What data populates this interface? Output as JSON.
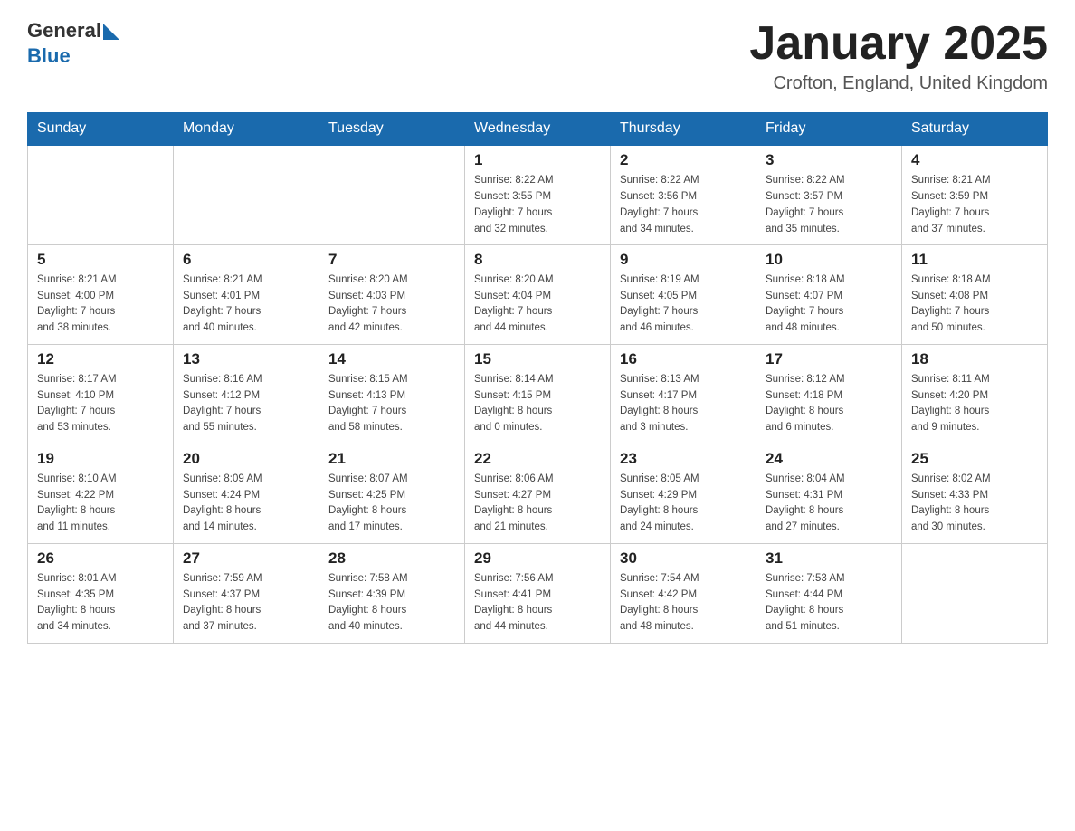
{
  "header": {
    "logo_general": "General",
    "logo_blue": "Blue",
    "title": "January 2025",
    "subtitle": "Crofton, England, United Kingdom"
  },
  "weekdays": [
    "Sunday",
    "Monday",
    "Tuesday",
    "Wednesday",
    "Thursday",
    "Friday",
    "Saturday"
  ],
  "weeks": [
    [
      {
        "day": "",
        "info": ""
      },
      {
        "day": "",
        "info": ""
      },
      {
        "day": "",
        "info": ""
      },
      {
        "day": "1",
        "info": "Sunrise: 8:22 AM\nSunset: 3:55 PM\nDaylight: 7 hours\nand 32 minutes."
      },
      {
        "day": "2",
        "info": "Sunrise: 8:22 AM\nSunset: 3:56 PM\nDaylight: 7 hours\nand 34 minutes."
      },
      {
        "day": "3",
        "info": "Sunrise: 8:22 AM\nSunset: 3:57 PM\nDaylight: 7 hours\nand 35 minutes."
      },
      {
        "day": "4",
        "info": "Sunrise: 8:21 AM\nSunset: 3:59 PM\nDaylight: 7 hours\nand 37 minutes."
      }
    ],
    [
      {
        "day": "5",
        "info": "Sunrise: 8:21 AM\nSunset: 4:00 PM\nDaylight: 7 hours\nand 38 minutes."
      },
      {
        "day": "6",
        "info": "Sunrise: 8:21 AM\nSunset: 4:01 PM\nDaylight: 7 hours\nand 40 minutes."
      },
      {
        "day": "7",
        "info": "Sunrise: 8:20 AM\nSunset: 4:03 PM\nDaylight: 7 hours\nand 42 minutes."
      },
      {
        "day": "8",
        "info": "Sunrise: 8:20 AM\nSunset: 4:04 PM\nDaylight: 7 hours\nand 44 minutes."
      },
      {
        "day": "9",
        "info": "Sunrise: 8:19 AM\nSunset: 4:05 PM\nDaylight: 7 hours\nand 46 minutes."
      },
      {
        "day": "10",
        "info": "Sunrise: 8:18 AM\nSunset: 4:07 PM\nDaylight: 7 hours\nand 48 minutes."
      },
      {
        "day": "11",
        "info": "Sunrise: 8:18 AM\nSunset: 4:08 PM\nDaylight: 7 hours\nand 50 minutes."
      }
    ],
    [
      {
        "day": "12",
        "info": "Sunrise: 8:17 AM\nSunset: 4:10 PM\nDaylight: 7 hours\nand 53 minutes."
      },
      {
        "day": "13",
        "info": "Sunrise: 8:16 AM\nSunset: 4:12 PM\nDaylight: 7 hours\nand 55 minutes."
      },
      {
        "day": "14",
        "info": "Sunrise: 8:15 AM\nSunset: 4:13 PM\nDaylight: 7 hours\nand 58 minutes."
      },
      {
        "day": "15",
        "info": "Sunrise: 8:14 AM\nSunset: 4:15 PM\nDaylight: 8 hours\nand 0 minutes."
      },
      {
        "day": "16",
        "info": "Sunrise: 8:13 AM\nSunset: 4:17 PM\nDaylight: 8 hours\nand 3 minutes."
      },
      {
        "day": "17",
        "info": "Sunrise: 8:12 AM\nSunset: 4:18 PM\nDaylight: 8 hours\nand 6 minutes."
      },
      {
        "day": "18",
        "info": "Sunrise: 8:11 AM\nSunset: 4:20 PM\nDaylight: 8 hours\nand 9 minutes."
      }
    ],
    [
      {
        "day": "19",
        "info": "Sunrise: 8:10 AM\nSunset: 4:22 PM\nDaylight: 8 hours\nand 11 minutes."
      },
      {
        "day": "20",
        "info": "Sunrise: 8:09 AM\nSunset: 4:24 PM\nDaylight: 8 hours\nand 14 minutes."
      },
      {
        "day": "21",
        "info": "Sunrise: 8:07 AM\nSunset: 4:25 PM\nDaylight: 8 hours\nand 17 minutes."
      },
      {
        "day": "22",
        "info": "Sunrise: 8:06 AM\nSunset: 4:27 PM\nDaylight: 8 hours\nand 21 minutes."
      },
      {
        "day": "23",
        "info": "Sunrise: 8:05 AM\nSunset: 4:29 PM\nDaylight: 8 hours\nand 24 minutes."
      },
      {
        "day": "24",
        "info": "Sunrise: 8:04 AM\nSunset: 4:31 PM\nDaylight: 8 hours\nand 27 minutes."
      },
      {
        "day": "25",
        "info": "Sunrise: 8:02 AM\nSunset: 4:33 PM\nDaylight: 8 hours\nand 30 minutes."
      }
    ],
    [
      {
        "day": "26",
        "info": "Sunrise: 8:01 AM\nSunset: 4:35 PM\nDaylight: 8 hours\nand 34 minutes."
      },
      {
        "day": "27",
        "info": "Sunrise: 7:59 AM\nSunset: 4:37 PM\nDaylight: 8 hours\nand 37 minutes."
      },
      {
        "day": "28",
        "info": "Sunrise: 7:58 AM\nSunset: 4:39 PM\nDaylight: 8 hours\nand 40 minutes."
      },
      {
        "day": "29",
        "info": "Sunrise: 7:56 AM\nSunset: 4:41 PM\nDaylight: 8 hours\nand 44 minutes."
      },
      {
        "day": "30",
        "info": "Sunrise: 7:54 AM\nSunset: 4:42 PM\nDaylight: 8 hours\nand 48 minutes."
      },
      {
        "day": "31",
        "info": "Sunrise: 7:53 AM\nSunset: 4:44 PM\nDaylight: 8 hours\nand 51 minutes."
      },
      {
        "day": "",
        "info": ""
      }
    ]
  ]
}
